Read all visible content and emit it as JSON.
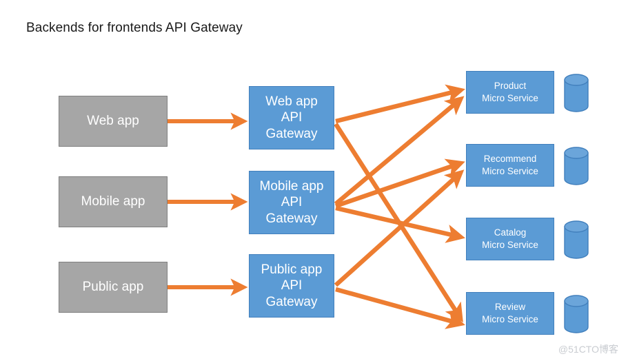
{
  "title": "Backends for frontends API Gateway",
  "watermark": "@51CTO博客",
  "colors": {
    "client_fill": "#a6a6a6",
    "client_stroke": "#7f7f7f",
    "node_fill": "#5b9bd5",
    "node_stroke": "#417fbc",
    "arrow": "#ed7d31",
    "text_on_node": "#ffffff",
    "title_text": "#1a1a1a",
    "watermark_text": "#c9ccd1"
  },
  "clients": [
    {
      "label": "Web app"
    },
    {
      "label": "Mobile app"
    },
    {
      "label": "Public app"
    }
  ],
  "gateways": [
    {
      "line1": "Web app",
      "line2": "API",
      "line3": "Gateway"
    },
    {
      "line1": "Mobile app",
      "line2": "API",
      "line3": "Gateway"
    },
    {
      "line1": "Public app",
      "line2": "API",
      "line3": "Gateway"
    }
  ],
  "services": [
    {
      "line1": "Product",
      "line2": "Micro Service",
      "database": "database-cylinder"
    },
    {
      "line1": "Recommend",
      "line2": "Micro Service",
      "database": "database-cylinder"
    },
    {
      "line1": "Catalog",
      "line2": "Micro Service",
      "database": "database-cylinder"
    },
    {
      "line1": "Review",
      "line2": "Micro Service",
      "database": "database-cylinder"
    }
  ],
  "connections": [
    {
      "from": "Web app",
      "to": "Web app API Gateway"
    },
    {
      "from": "Mobile app",
      "to": "Mobile app API Gateway"
    },
    {
      "from": "Public app",
      "to": "Public app API Gateway"
    },
    {
      "from": "Web app API Gateway",
      "to": "Product Micro Service"
    },
    {
      "from": "Web app API Gateway",
      "to": "Review Micro Service"
    },
    {
      "from": "Mobile app API Gateway",
      "to": "Product Micro Service"
    },
    {
      "from": "Mobile app API Gateway",
      "to": "Recommend Micro Service"
    },
    {
      "from": "Mobile app API Gateway",
      "to": "Catalog Micro Service"
    },
    {
      "from": "Public app API Gateway",
      "to": "Recommend Micro Service"
    },
    {
      "from": "Public app API Gateway",
      "to": "Review Micro Service"
    }
  ]
}
